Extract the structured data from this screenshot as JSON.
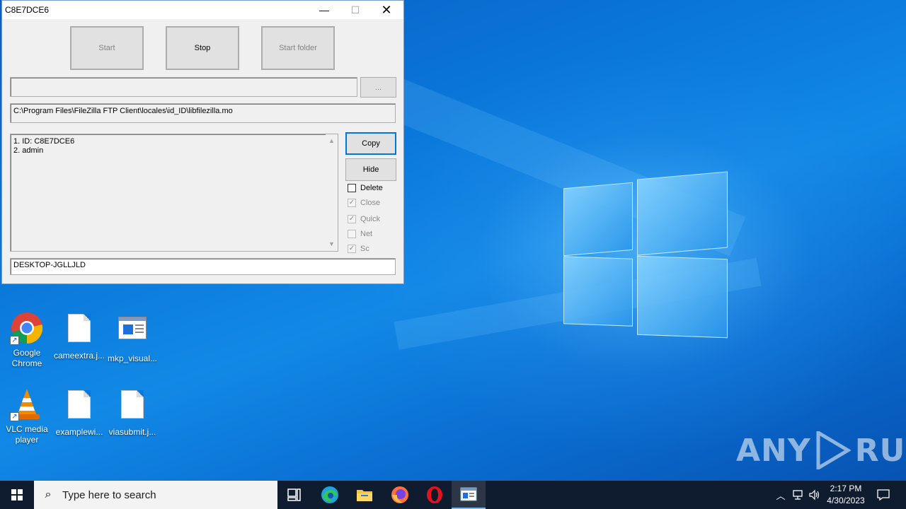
{
  "window": {
    "title": "C8E7DCE6",
    "controls": {
      "minimize": "—",
      "maximize": "☐",
      "close": "✕"
    },
    "buttons": {
      "start": "Start",
      "stop": "Stop",
      "start_folder": "Start folder",
      "browse": "...",
      "copy": "Copy",
      "hide": "Hide"
    },
    "path_input": "",
    "current_file": "C:\\Program Files\\FileZilla FTP Client\\locales\\id_ID\\libfilezilla.mo",
    "log_lines": [
      "1. ID: C8E7DCE6",
      "2. admin"
    ],
    "computer_name": "DESKTOP-JGLLJLD",
    "checkboxes": [
      {
        "label": "Delete",
        "checked": false,
        "enabled": true
      },
      {
        "label": "Close",
        "checked": true,
        "enabled": false
      },
      {
        "label": "Quick",
        "checked": true,
        "enabled": false
      },
      {
        "label": "Net",
        "checked": false,
        "enabled": false
      },
      {
        "label": "Sc",
        "checked": true,
        "enabled": false
      }
    ]
  },
  "desktop": {
    "icons": [
      {
        "label": "Google Chrome",
        "icon": "chrome-icon"
      },
      {
        "label": "cameextra.j...",
        "icon": "file-icon"
      },
      {
        "label": "mkp_visual...",
        "icon": "app-window-icon"
      },
      {
        "label": "VLC media player",
        "icon": "vlc-icon"
      },
      {
        "label": "examplewi...",
        "icon": "file-icon"
      },
      {
        "label": "viasubmit.j...",
        "icon": "file-icon"
      }
    ],
    "watermark": "ANY RUN"
  },
  "taskbar": {
    "search_placeholder": "Type here to search",
    "apps": [
      "task-view-icon",
      "edge-icon",
      "file-explorer-icon",
      "firefox-icon",
      "opera-icon",
      "app-window-icon"
    ],
    "time": "2:17 PM",
    "date": "4/30/2023"
  }
}
